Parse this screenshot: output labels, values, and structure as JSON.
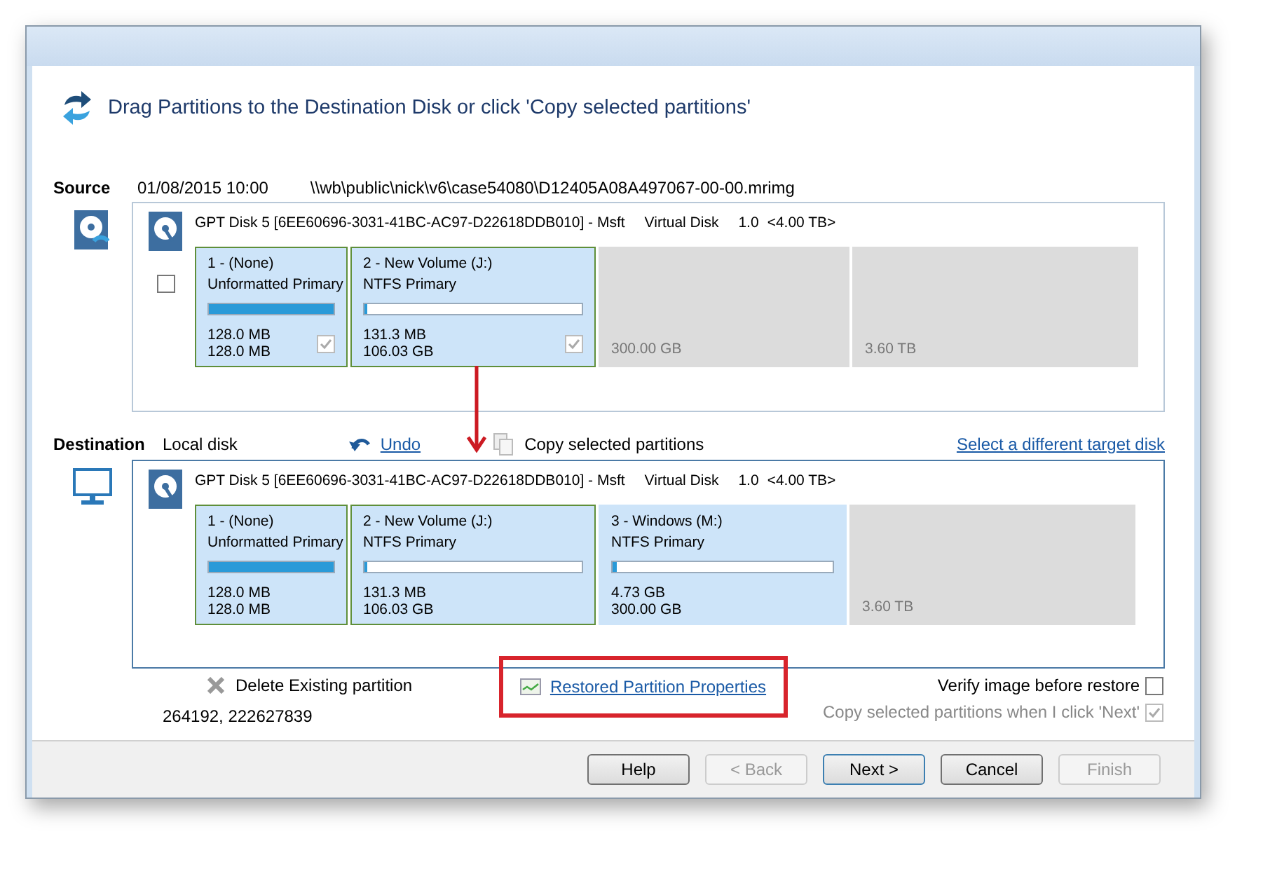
{
  "header": {
    "title": "Drag Partitions to the Destination Disk or click 'Copy selected partitions'"
  },
  "source": {
    "label": "Source",
    "date": "01/08/2015 10:00",
    "path": "\\\\wb\\public\\nick\\v6\\case54080\\D12405A08A497067-00-00.mrimg"
  },
  "source_disk": {
    "name": "GPT Disk 5 [6EE60696-3031-41BC-AC97-D22618DDB010] - Msft",
    "type": "Virtual Disk",
    "version": "1.0",
    "size": "<4.00 TB>",
    "checked": false,
    "partitions": [
      {
        "kind": "partition",
        "title": "1 -  (None)",
        "type": "Unformatted Primary",
        "level": 1,
        "used": "128.0 MB",
        "total": "128.0 MB",
        "checked": true,
        "selected": true
      },
      {
        "kind": "partition",
        "title": "2 - New Volume (J:)",
        "type": "NTFS Primary",
        "level": 0.01,
        "used": "131.3 MB",
        "total": "106.03 GB",
        "checked": true,
        "selected": true
      },
      {
        "kind": "unallocated",
        "total": "300.00 GB"
      },
      {
        "kind": "unallocated",
        "total": "3.60 TB"
      }
    ]
  },
  "destination": {
    "label": "Destination",
    "location": "Local disk",
    "undo": "Undo",
    "copy": "Copy selected partitions",
    "select_disk": "Select a different target disk"
  },
  "destination_disk": {
    "name": "GPT Disk 5 [6EE60696-3031-41BC-AC97-D22618DDB010] - Msft",
    "type": "Virtual Disk",
    "version": "1.0",
    "size": "<4.00 TB>",
    "partitions": [
      {
        "kind": "partition",
        "title": "1 -  (None)",
        "type": "Unformatted Primary",
        "level": 1,
        "used": "128.0 MB",
        "total": "128.0 MB",
        "selected": true
      },
      {
        "kind": "partition",
        "title": "2 - New Volume (J:)",
        "type": "NTFS Primary",
        "level": 0.01,
        "used": "131.3 MB",
        "total": "106.03 GB",
        "selected": true
      },
      {
        "kind": "partition",
        "title": "3 - Windows (M:)",
        "type": "NTFS Primary",
        "level": 0.02,
        "used": "4.73 GB",
        "total": "300.00 GB",
        "selected": false
      },
      {
        "kind": "unallocated",
        "total": "3.60 TB"
      }
    ]
  },
  "options": {
    "delete": "Delete Existing partition",
    "restored_properties": "Restored Partition Properties",
    "range": "264192, 222627839",
    "checkboxes": [
      {
        "label": "Verify image before restore",
        "checked": false,
        "disabled": false
      },
      {
        "label": "Copy selected partitions when I click 'Next'",
        "checked": true,
        "disabled": true
      }
    ]
  },
  "buttons": [
    {
      "label": "Help",
      "disabled": false,
      "default": false
    },
    {
      "label": "< Back",
      "disabled": true,
      "default": false
    },
    {
      "label": "Next >",
      "disabled": false,
      "default": true
    },
    {
      "label": "Cancel",
      "disabled": false,
      "default": false
    },
    {
      "label": "Finish",
      "disabled": true,
      "default": false
    }
  ]
}
